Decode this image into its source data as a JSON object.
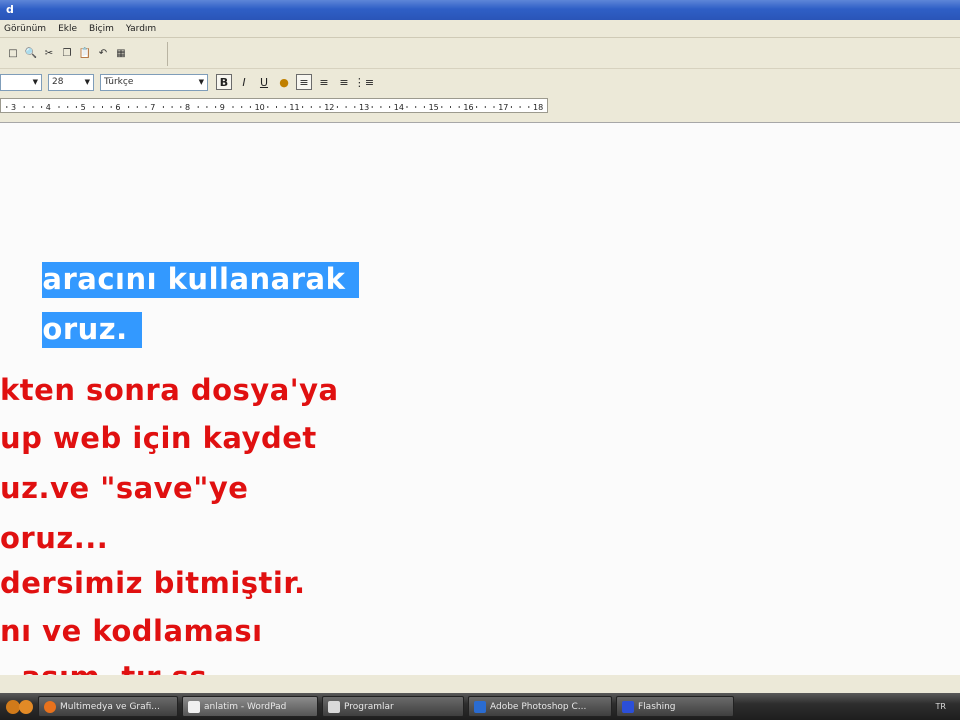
{
  "window": {
    "title": "d"
  },
  "menu": [
    "Görünüm",
    "Ekle",
    "Biçim",
    "Yardım"
  ],
  "format": {
    "font_size": "28",
    "script": "Türkçe"
  },
  "ruler": [
    "3",
    "4",
    "5",
    "6",
    "7",
    "8",
    "9",
    "10",
    "11",
    "12",
    "13",
    "14",
    "15",
    "16",
    "17",
    "18"
  ],
  "document": {
    "selected_lines": [
      "aracını kullanarak",
      "oruz."
    ],
    "lines": [
      "kten sonra dosya'ya",
      "up web için kaydet",
      "uz.ve \"save\"ye",
      "oruz...",
      "dersimiz bitmiştir.",
      "nı ve kodlaması",
      "  asım  tır ss"
    ],
    "text_color": "#e01010",
    "selection_color": "#3399ff"
  },
  "taskbar": {
    "tasks": [
      {
        "label": "Multimedya ve Grafi...",
        "icon": "firefox-icon",
        "color": "#e8721c"
      },
      {
        "label": "anlatim - WordPad",
        "icon": "wordpad-icon",
        "color": "#f0f0f0",
        "active": true
      },
      {
        "label": "Programlar",
        "icon": "folder-icon",
        "color": "#d9d9d9"
      },
      {
        "label": "Adobe Photoshop C...",
        "icon": "photoshop-icon",
        "color": "#2a6cd1"
      },
      {
        "label": "Flashing",
        "icon": "flash-icon",
        "color": "#2b4fd8"
      }
    ],
    "tray": "TR"
  }
}
